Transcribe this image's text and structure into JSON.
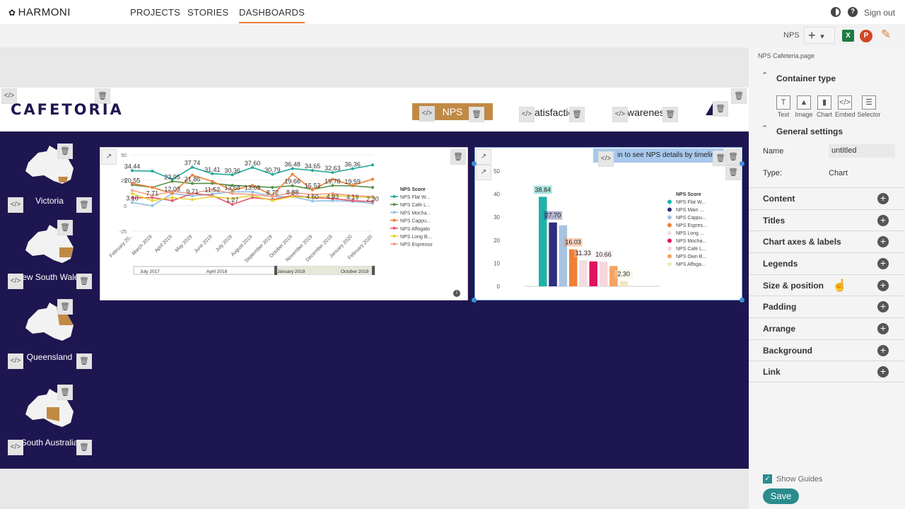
{
  "app": {
    "brand": "HARMONI",
    "sign_out": "Sign out"
  },
  "nav": {
    "tabs": [
      "PROJECTS",
      "STORIES",
      "DASHBOARDS"
    ],
    "active": "DASHBOARDS"
  },
  "toolbar": {
    "page_name": "NPS",
    "excel": "X",
    "ppt": "P"
  },
  "canvas": {
    "logo_text": "CAFETORIA",
    "nps_button": "NPS",
    "header_items": [
      "atisfactio",
      "warenes"
    ],
    "tooltip_text": "in to see NPS details by timeline",
    "states": [
      "Victoria",
      "New South Wales",
      "Queensland",
      "South Australia"
    ],
    "slider_labels": [
      "July 2017",
      "April 2018",
      "January 2019",
      "October 2019"
    ]
  },
  "chart_data": [
    {
      "type": "line",
      "title": "",
      "legend_title": "NPS Score",
      "legend_position": "right",
      "x": [
        "February 20..",
        "March 2019",
        "April 2019",
        "May 2019",
        "June 2019",
        "July 2019",
        "August 2019",
        "September 2019",
        "October 2019",
        "November 2019",
        "December 2019",
        "January 2020",
        "February 2020"
      ],
      "ylim": [
        -25,
        50
      ],
      "yticks": [
        50,
        25,
        0,
        -25
      ],
      "series": [
        {
          "name": "NPS Flat W...",
          "color": "#1fa99a",
          "values": [
            34.44,
            34.0,
            26,
            37.74,
            31.41,
            30.36,
            37.6,
            30.79,
            36.48,
            34.65,
            32.63,
            36.36,
            40
          ]
        },
        {
          "name": "NPS Cafe L...",
          "color": "#5b8f47",
          "values": [
            20.55,
            18,
            23.95,
            21.86,
            22,
            20,
            19,
            18,
            19.66,
            16,
            19.78,
            19.59,
            18
          ]
        },
        {
          "name": "NPS Mocha...",
          "color": "#8fc1e3",
          "values": [
            3.1,
            0,
            12.03,
            9.71,
            11.52,
            13.68,
            13.69,
            8.72,
            8.88,
            4.6,
            4.93,
            4.19,
            2.3
          ]
        },
        {
          "name": "NPS Cappu...",
          "color": "#f07f36",
          "values": [
            22,
            18,
            12,
            30,
            24,
            15,
            20,
            10,
            31,
            15.53,
            26,
            20,
            26
          ]
        },
        {
          "name": "NPS Affogato",
          "color": "#e8566a",
          "values": [
            7.71,
            8,
            5,
            12,
            10,
            1.27,
            8,
            6,
            10,
            8,
            7,
            5,
            4
          ]
        },
        {
          "name": "NPS Long B...",
          "color": "#e6d43a",
          "values": [
            12,
            5,
            8,
            6,
            9,
            7,
            10,
            5,
            9,
            8,
            10,
            9,
            8
          ]
        },
        {
          "name": "NPS Espresso",
          "color": "#f5a08a",
          "values": [
            15,
            10,
            14,
            12,
            16,
            12,
            11,
            9,
            13,
            11,
            12,
            10,
            9
          ]
        }
      ],
      "labels": [
        {
          "series": 0,
          "idx": 0,
          "text": "34.44"
        },
        {
          "series": 1,
          "idx": 0,
          "text": "20.55"
        },
        {
          "series": 2,
          "idx": 0,
          "text": "3.10"
        },
        {
          "series": 4,
          "idx": 1,
          "text": "7.71"
        },
        {
          "series": 1,
          "idx": 2,
          "text": "23.95"
        },
        {
          "series": 2,
          "idx": 2,
          "text": "12.03"
        },
        {
          "series": 0,
          "idx": 3,
          "text": "37.74"
        },
        {
          "series": 1,
          "idx": 3,
          "text": "21.86"
        },
        {
          "series": 2,
          "idx": 3,
          "text": "9.71"
        },
        {
          "series": 0,
          "idx": 4,
          "text": "31.41"
        },
        {
          "series": 2,
          "idx": 4,
          "text": "11.52"
        },
        {
          "series": 0,
          "idx": 5,
          "text": "30.36"
        },
        {
          "series": 2,
          "idx": 5,
          "text": "13.68"
        },
        {
          "series": 4,
          "idx": 5,
          "text": "1.27"
        },
        {
          "series": 0,
          "idx": 6,
          "text": "37.60"
        },
        {
          "series": 2,
          "idx": 6,
          "text": "13.69"
        },
        {
          "series": 0,
          "idx": 7,
          "text": "30.79"
        },
        {
          "series": 2,
          "idx": 7,
          "text": "8.72"
        },
        {
          "series": 0,
          "idx": 8,
          "text": "36.48"
        },
        {
          "series": 1,
          "idx": 8,
          "text": "19.66"
        },
        {
          "series": 2,
          "idx": 8,
          "text": "8.88"
        },
        {
          "series": 0,
          "idx": 9,
          "text": "34.65"
        },
        {
          "series": 3,
          "idx": 9,
          "text": "15.53"
        },
        {
          "series": 2,
          "idx": 9,
          "text": "4.60"
        },
        {
          "series": 0,
          "idx": 10,
          "text": "32.63"
        },
        {
          "series": 1,
          "idx": 10,
          "text": "19.78"
        },
        {
          "series": 2,
          "idx": 10,
          "text": "4.93"
        },
        {
          "series": 0,
          "idx": 11,
          "text": "36.36"
        },
        {
          "series": 1,
          "idx": 11,
          "text": "19.59"
        },
        {
          "series": 2,
          "idx": 11,
          "text": "4.19"
        },
        {
          "series": 2,
          "idx": 12,
          "text": "2.30"
        }
      ]
    },
    {
      "type": "bar",
      "title": "",
      "legend_title": "NPS Score",
      "legend_position": "right",
      "ylim": [
        0,
        50
      ],
      "yticks": [
        50,
        40,
        30,
        20,
        10,
        0
      ],
      "categories": [
        "NPS Flat W...",
        "NPS Main ...",
        "NPS Cappu...",
        "NPS Espres...",
        "NPS Long ...",
        "NPS Mocha...",
        "NPS Cafe L...",
        "NPS Own B...",
        "NPS Affoga..."
      ],
      "values": [
        38.84,
        27.7,
        26.5,
        16.03,
        11.33,
        10.8,
        10.66,
        8.8,
        2.3
      ],
      "labels": [
        "38.84",
        "27.70",
        "",
        "16.03",
        "11.33",
        "",
        "10.66",
        "",
        "2.30"
      ],
      "colors": [
        "#1fb3a8",
        "#2f2d7d",
        "#a8c4e0",
        "#f07f36",
        "#f2dede",
        "#e0115f",
        "#f7d6dc",
        "#f4a261",
        "#efe8c0"
      ]
    }
  ],
  "panel": {
    "file_name": "NPS Cafeteria.page",
    "container_type": "Container type",
    "types": [
      "Text",
      "Image",
      "Chart",
      "Embed",
      "Selector"
    ],
    "general_settings": "General settings",
    "name_label": "Name",
    "name_value": "untitled",
    "type_label": "Type:",
    "type_value": "Chart",
    "sections": [
      "Content",
      "Titles",
      "Chart axes & labels",
      "Legends",
      "Size & position",
      "Padding",
      "Arrange",
      "Background",
      "Link"
    ],
    "show_guides": "Show Guides",
    "save": "Save"
  }
}
